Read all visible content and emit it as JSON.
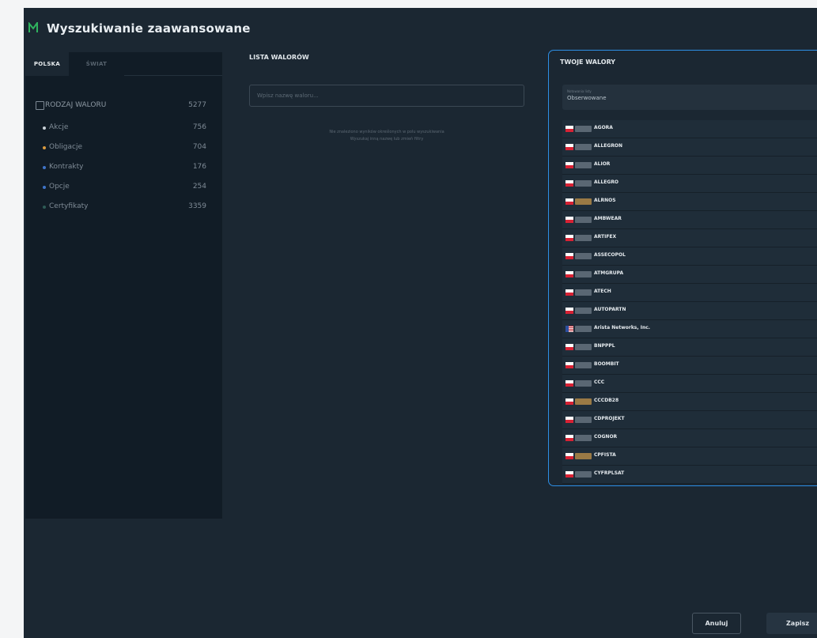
{
  "window": {
    "title": "Wyszukiwanie zaawansowane"
  },
  "colors": {
    "accent_border": "#2d8fe6",
    "background": "#1b2732",
    "panel": "#111c26"
  },
  "left_panel": {
    "tabs": [
      {
        "label": "POLSKA",
        "active": true
      },
      {
        "label": "ŚWIAT",
        "active": false
      }
    ],
    "root": {
      "label": "RODZAJ WALORU",
      "count": "5277"
    },
    "categories": [
      {
        "label": "Akcje",
        "count": "756",
        "color": "#c8d0d6"
      },
      {
        "label": "Obligacje",
        "count": "704",
        "color": "#d99a3e"
      },
      {
        "label": "Kontrakty",
        "count": "176",
        "color": "#3f74c8"
      },
      {
        "label": "Opcje",
        "count": "254",
        "color": "#3f74c8"
      },
      {
        "label": "Certyfikaty",
        "count": "3359",
        "color": "#2d5b55"
      }
    ]
  },
  "middle_panel": {
    "heading": "LISTA WALORÓW",
    "search_placeholder": "Wpisz nazwę waloru...",
    "hint_line1": "Nie znaleziono wyników określonych w polu wyszukiwania",
    "hint_line2": "Wyszukaj inną nazwę lub zmień filtry"
  },
  "right_panel": {
    "heading": "TWOJE WALORY",
    "select": {
      "label": "Notowania listy",
      "value": "Obserwowane",
      "icon": "chevron-down-icon"
    },
    "instruments": [
      {
        "name": "AGORA",
        "flag": "pl",
        "chip": "stock"
      },
      {
        "name": "ALLEGRON",
        "flag": "pl",
        "chip": "stock"
      },
      {
        "name": "ALIOR",
        "flag": "pl",
        "chip": "stock"
      },
      {
        "name": "ALLEGRO",
        "flag": "pl",
        "chip": "stock"
      },
      {
        "name": "ALRNOS",
        "flag": "pl",
        "chip": "bond"
      },
      {
        "name": "AMBWEAR",
        "flag": "pl",
        "chip": "stock"
      },
      {
        "name": "ARTIFEX",
        "flag": "pl",
        "chip": "stock"
      },
      {
        "name": "ASSECOPOL",
        "flag": "pl",
        "chip": "stock"
      },
      {
        "name": "ATMGRUPA",
        "flag": "pl",
        "chip": "stock"
      },
      {
        "name": "ATECH",
        "flag": "pl",
        "chip": "stock"
      },
      {
        "name": "AUTOPARTN",
        "flag": "pl",
        "chip": "stock"
      },
      {
        "name": "Arista Networks, Inc.",
        "flag": "us",
        "chip": "stock"
      },
      {
        "name": "BNPPPL",
        "flag": "pl",
        "chip": "stock"
      },
      {
        "name": "BOOMBIT",
        "flag": "pl",
        "chip": "stock"
      },
      {
        "name": "CCC",
        "flag": "pl",
        "chip": "stock"
      },
      {
        "name": "CCCDB28",
        "flag": "pl",
        "chip": "bond"
      },
      {
        "name": "CDPROJEKT",
        "flag": "pl",
        "chip": "stock"
      },
      {
        "name": "COGNOR",
        "flag": "pl",
        "chip": "stock"
      },
      {
        "name": "CPFISTA",
        "flag": "pl",
        "chip": "bond"
      },
      {
        "name": "CYFRPLSAT",
        "flag": "pl",
        "chip": "stock"
      }
    ]
  },
  "footer": {
    "cancel_label": "Anuluj",
    "save_label": "Zapisz"
  }
}
